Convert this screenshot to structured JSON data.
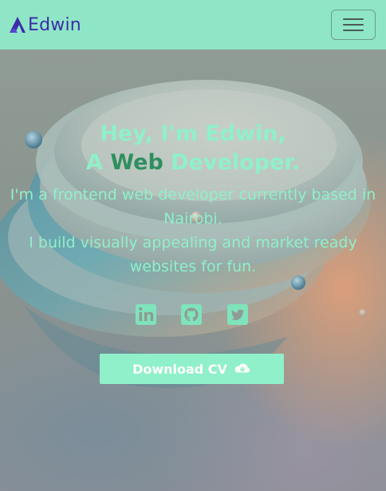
{
  "nav": {
    "brand": "Edwin",
    "brand_logo_icon": "a-logo-icon",
    "menu_icon": "hamburger-icon"
  },
  "hero": {
    "greeting_line1": "Hey, I'm Edwin,",
    "greeting_prefix": "A ",
    "greeting_accent": "Web",
    "greeting_suffix": " Developer.",
    "intro_line1": "I'm a frontend web developer currently based in Nairobi.",
    "intro_line2": "I build visually appealing and market ready websites for fun.",
    "socials": [
      "linkedin-icon",
      "github-icon",
      "twitter-icon"
    ],
    "cv_button": "Download CV",
    "cv_icon": "cloud-download-icon"
  },
  "colors": {
    "navbar": "#8fe6c7",
    "brand": "#3c2ca8",
    "text_mint": "#8ff0c9",
    "accent_green": "#2e8f5f",
    "social_icon": "#7fe3bc"
  }
}
